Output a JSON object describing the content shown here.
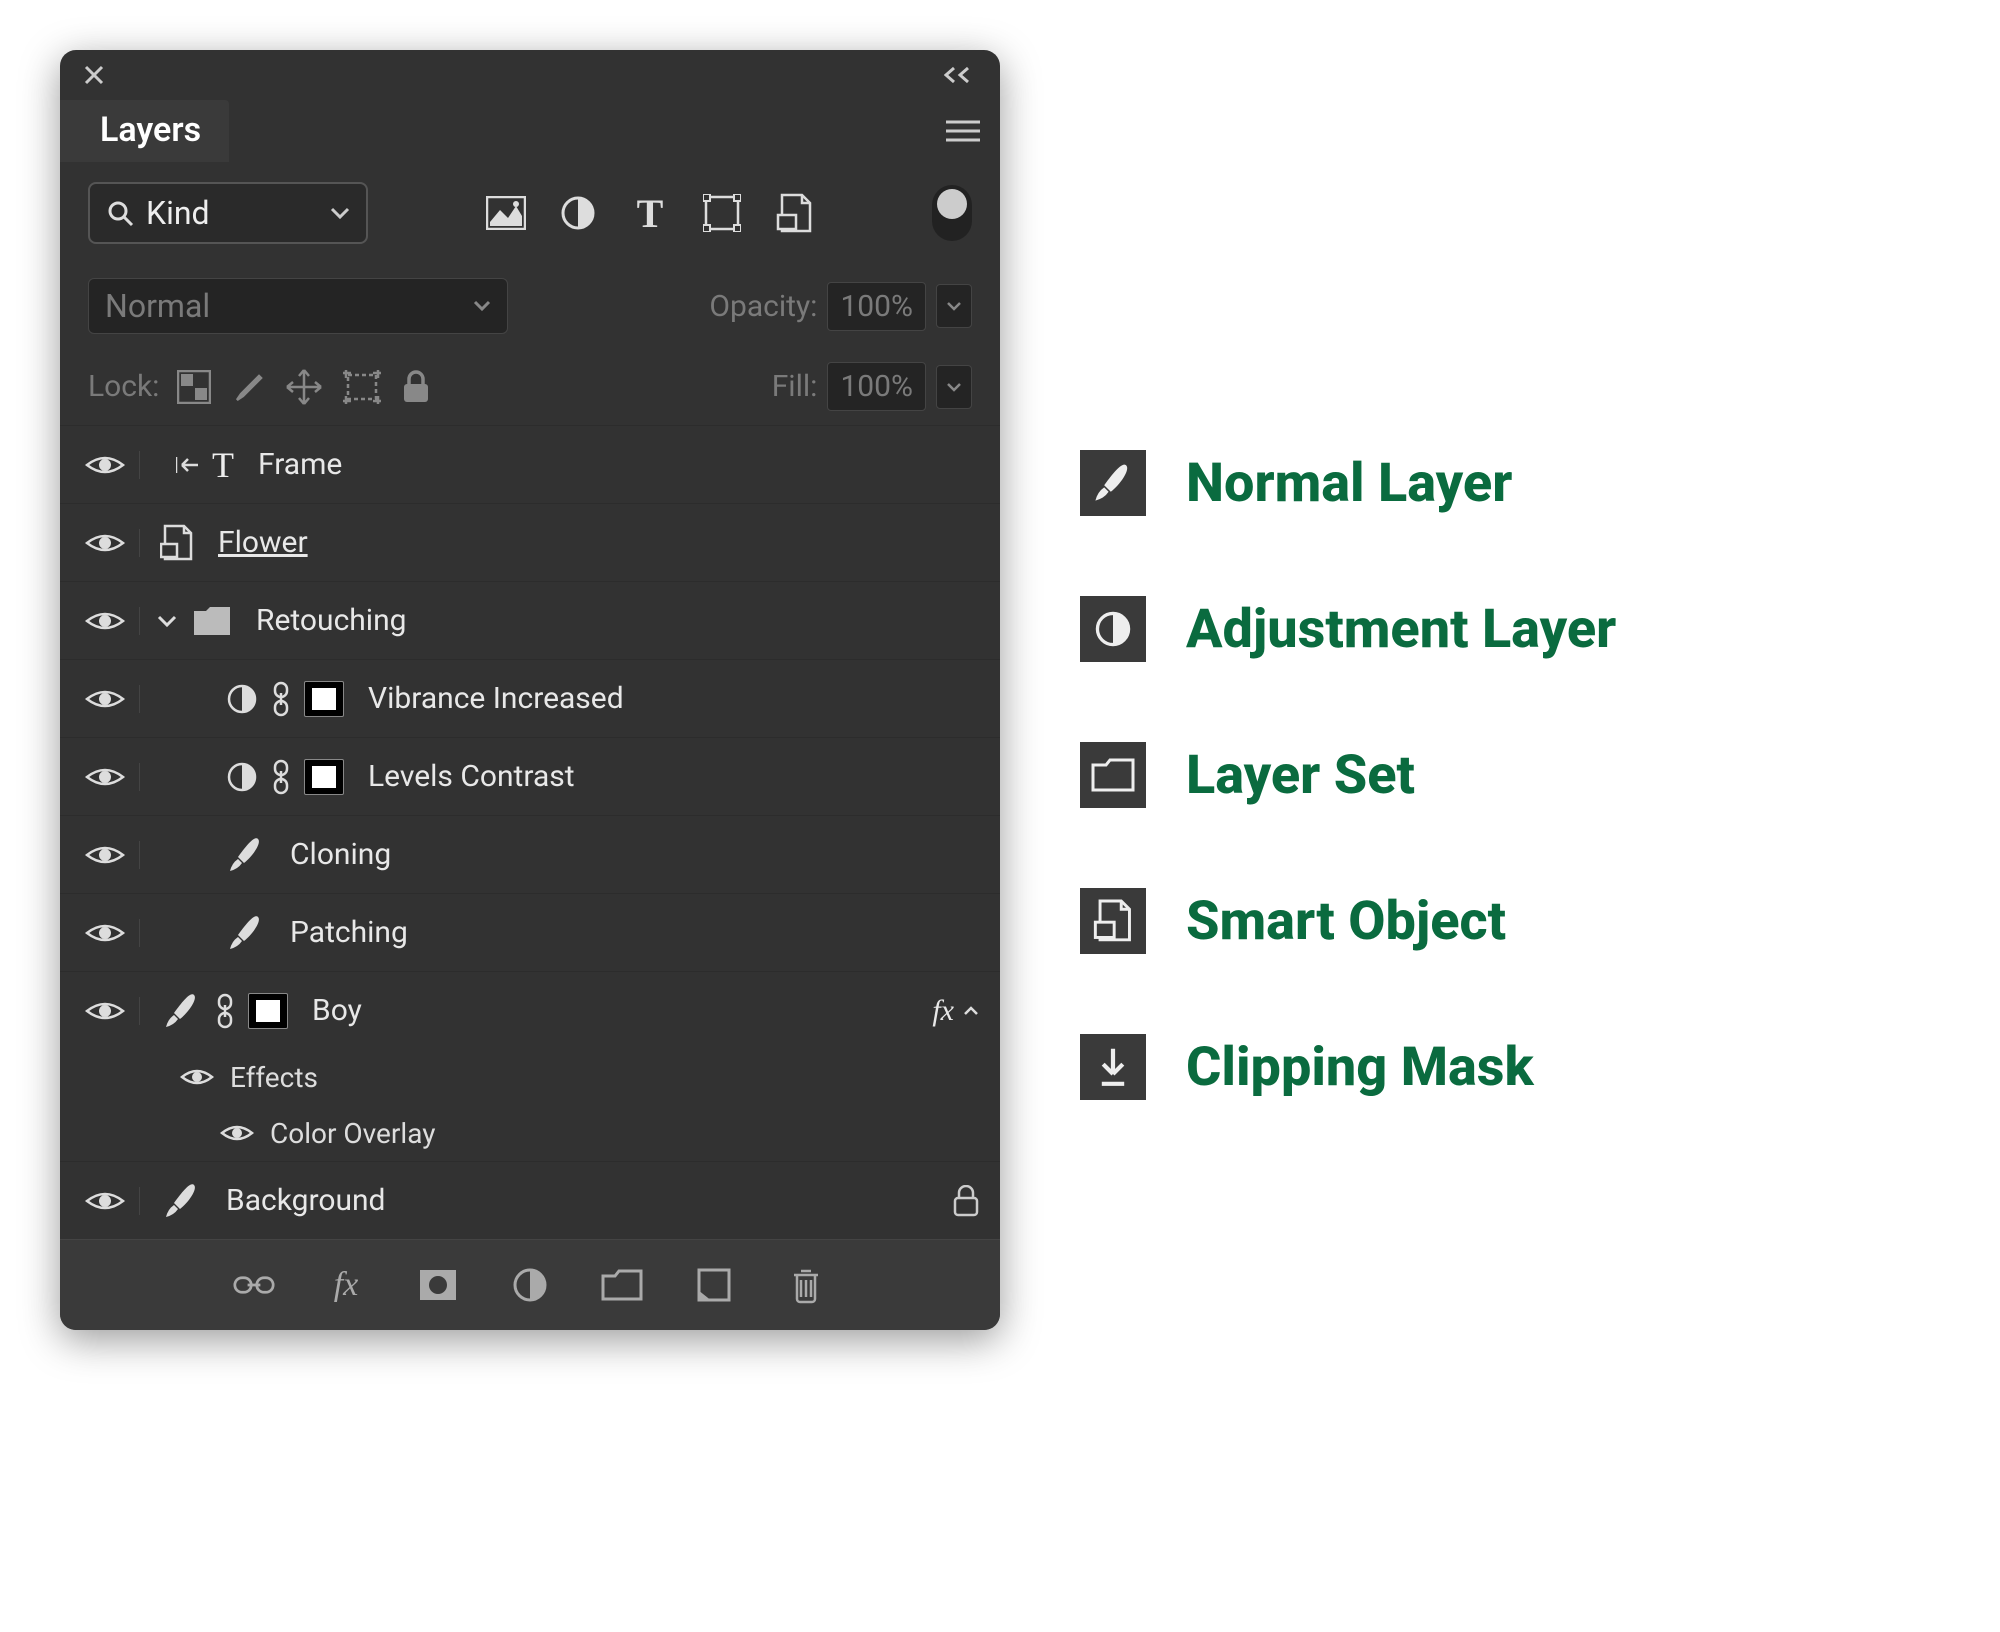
{
  "panel": {
    "tab_title": "Layers",
    "filter_kind": "Kind",
    "blend_mode": "Normal",
    "opacity_label": "Opacity:",
    "opacity_value": "100%",
    "lock_label": "Lock:",
    "fill_label": "Fill:",
    "fill_value": "100%"
  },
  "layers": [
    {
      "name": "Frame"
    },
    {
      "name": "Flower"
    },
    {
      "name": "Retouching"
    },
    {
      "name": "Vibrance Increased"
    },
    {
      "name": "Levels Contrast"
    },
    {
      "name": "Cloning"
    },
    {
      "name": "Patching"
    },
    {
      "name": "Boy",
      "fx": "fx"
    },
    {
      "effects_label": "Effects"
    },
    {
      "effect_name": "Color Overlay"
    },
    {
      "name": "Background"
    }
  ],
  "legend": [
    {
      "label": "Normal Layer"
    },
    {
      "label": "Adjustment Layer"
    },
    {
      "label": "Layer Set"
    },
    {
      "label": "Smart Object"
    },
    {
      "label": "Clipping Mask"
    }
  ]
}
